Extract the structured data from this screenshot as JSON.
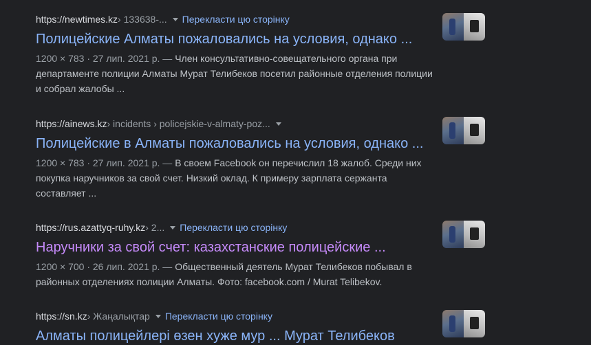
{
  "results": [
    {
      "domain": "https://newtimes.kz",
      "path": " › 133638-...",
      "translate": "Перекласти цю сторінку",
      "title": "Полицейские Алматы пожаловались на условия, однако ...",
      "meta": "1200 × 783 · 27 лип. 2021 р. — ",
      "snippet": "Член консультативно-совещательного органа при департаменте полиции Алматы Мурат Телибеков посетил районные отделения полиции и собрал жалобы ...",
      "visited": false
    },
    {
      "domain": "https://ainews.kz",
      "path": " › incidents › policejskie-v-almaty-poz...",
      "translate": "",
      "title": "Полицейские в Алматы пожаловались на условия, однако ...",
      "meta": "1200 × 783 · 27 лип. 2021 р. — ",
      "snippet": "В своем Facebook он перечислил 18 жалоб. Среди них покупка наручников за свой счет. Низкий оклад. К примеру зарплата сержанта составляет ...",
      "visited": false
    },
    {
      "domain": "https://rus.azattyq-ruhy.kz",
      "path": " › 2...",
      "translate": "Перекласти цю сторінку",
      "title": "Наручники за свой счет: казахстанские полицейские ...",
      "meta": "1200 × 700 · 26 лип. 2021 р. — ",
      "snippet": "Общественный деятель Мурат Телибеков побывал в районных отделениях полиции Алматы. Фото: facebook.com / Murat Telibekov.",
      "visited": true
    },
    {
      "domain": "https://sn.kz",
      "path": " › Жаңалықтар",
      "translate": "Перекласти цю сторінку",
      "title": "Алматы полицейлері өзен хуже мур ... Мурат Телибеков",
      "meta": "",
      "snippet": "",
      "visited": false
    }
  ]
}
